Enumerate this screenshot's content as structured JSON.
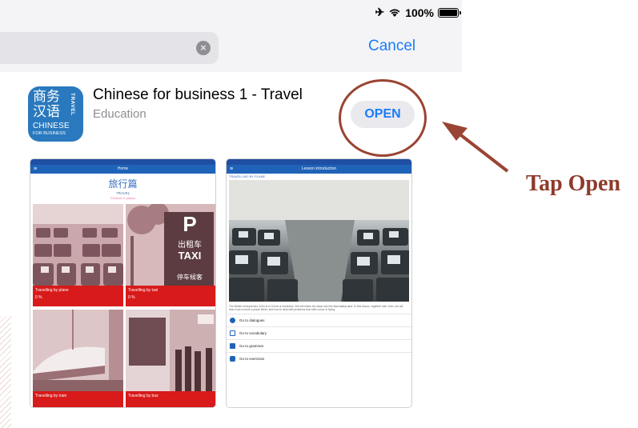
{
  "status": {
    "battery_pct": "100%"
  },
  "search": {
    "cancel_label": "Cancel"
  },
  "app": {
    "title": "Chinese for business 1 - Travel",
    "category": "Education",
    "open_label": "OPEN",
    "icon": {
      "zh_line1": "商务",
      "zh_line2": "汉语",
      "side": "TRAVEL",
      "word": "CHINESE",
      "subword": "FOR BUSINESS"
    }
  },
  "screenshot1": {
    "nav_title": "Home",
    "heading": "旅行篇",
    "sub": "TRAVEL",
    "sub2": "Chinese in places",
    "tiles": [
      {
        "caption": "Travelling by plane",
        "pct": "0 %"
      },
      {
        "caption": "Travelling by taxi",
        "pct": "0 %"
      },
      {
        "caption": "Travelling by train",
        "pct": ""
      },
      {
        "caption": "Travelling by bus",
        "pct": ""
      }
    ],
    "taxi_sign": {
      "p": "P",
      "zh": "出租车",
      "en": "TAXI",
      "zh2": "停车候客"
    }
  },
  "screenshot2": {
    "nav_title": "Lesson introduction",
    "section": "TRAVELLING BY PLANE",
    "description": "The British entrepreneur John is in China on business. We will follow his steps into this fascinating land. In this lesson, together with John, we will learn how to book a plane ticket, and how to deal with problems that often occur in flying.",
    "items": [
      "Go to dialogues",
      "Go to vocabulary",
      "Go to grammar",
      "Go to exercises"
    ]
  },
  "annotation": {
    "label": "Tap Open"
  },
  "colors": {
    "accent_blue": "#1a7cf5",
    "annotation_red": "#9a4433",
    "tile_red": "#d81a1a"
  }
}
